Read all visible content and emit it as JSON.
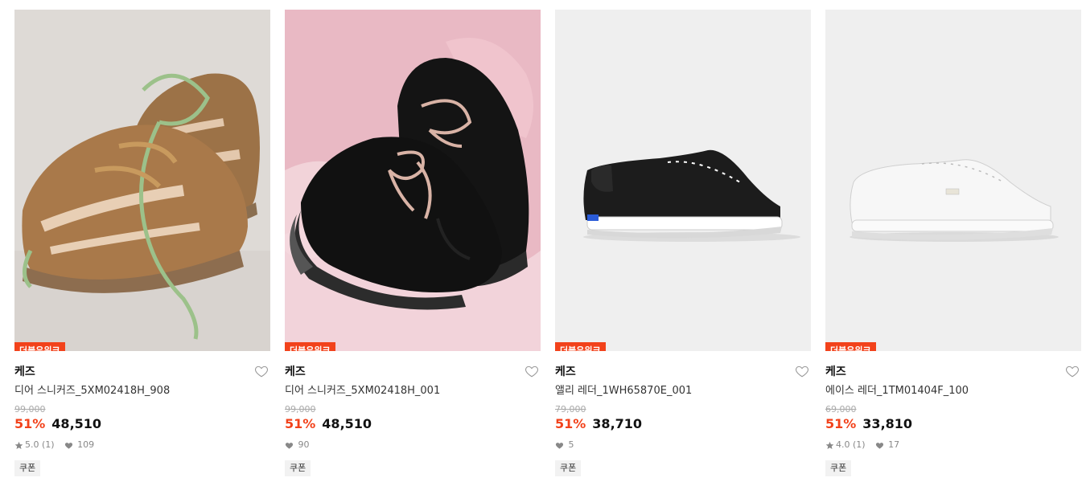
{
  "colors": {
    "accent": "#f2421b",
    "badge_bg": "#f2421b"
  },
  "products": [
    {
      "badge": "더블유위크",
      "brand": "케즈",
      "name": "디어 스니커즈_5XM02418H_908",
      "original_price": "99,000",
      "discount": "51%",
      "price": "48,510",
      "rating": "5.0",
      "review_count": "(1)",
      "likes": "109",
      "coupon": "쿠폰",
      "image_desc": "tan-sneakers"
    },
    {
      "badge": "더블유위크",
      "brand": "케즈",
      "name": "디어 스니커즈_5XM02418H_001",
      "original_price": "99,000",
      "discount": "51%",
      "price": "48,510",
      "likes": "90",
      "coupon": "쿠폰",
      "image_desc": "black-sneakers"
    },
    {
      "badge": "더블유위크",
      "brand": "케즈",
      "name": "앨리 레더_1WH65870E_001",
      "original_price": "79,000",
      "discount": "51%",
      "price": "38,710",
      "likes": "5",
      "coupon": "쿠폰",
      "image_desc": "black-leather-sneaker"
    },
    {
      "badge": "더블유위크",
      "brand": "케즈",
      "name": "에이스 레더_1TM01404F_100",
      "original_price": "69,000",
      "discount": "51%",
      "price": "33,810",
      "rating": "4.0",
      "review_count": "(1)",
      "likes": "17",
      "coupon": "쿠폰",
      "image_desc": "white-leather-sneaker"
    }
  ]
}
